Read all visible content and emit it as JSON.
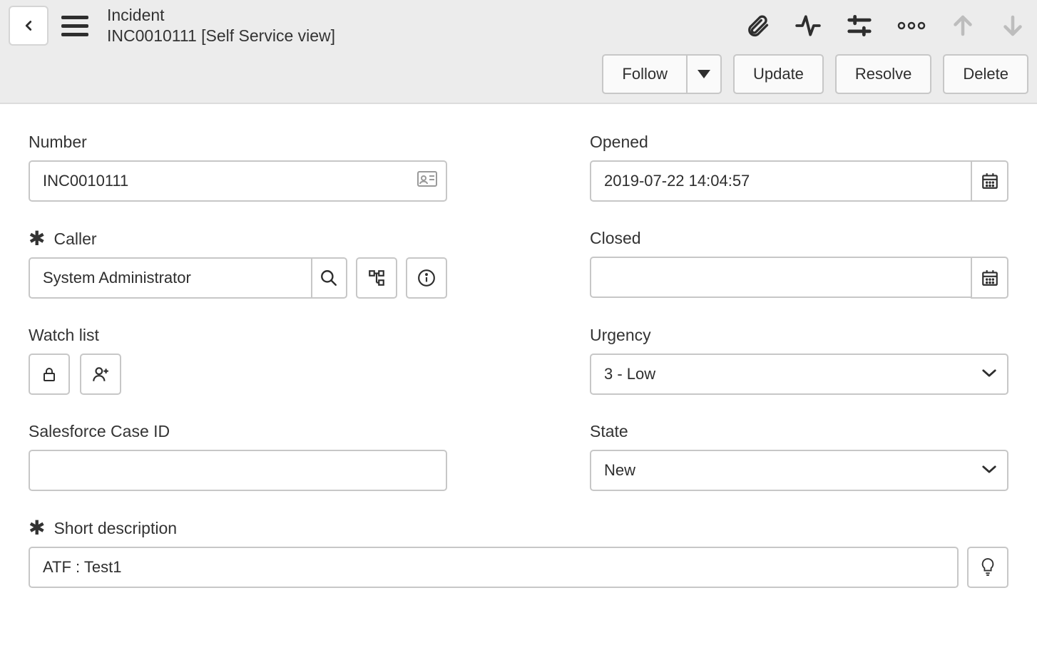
{
  "header": {
    "title": "Incident",
    "subtitle": "INC0010111 [Self Service view]"
  },
  "actions": {
    "follow": "Follow",
    "update": "Update",
    "resolve": "Resolve",
    "delete": "Delete"
  },
  "form": {
    "number": {
      "label": "Number",
      "value": "INC0010111"
    },
    "opened": {
      "label": "Opened",
      "value": "2019-07-22 14:04:57"
    },
    "caller": {
      "label": "Caller",
      "value": "System Administrator"
    },
    "closed": {
      "label": "Closed",
      "value": ""
    },
    "watch_list": {
      "label": "Watch list"
    },
    "urgency": {
      "label": "Urgency",
      "value": "3 - Low"
    },
    "salesforce": {
      "label": "Salesforce Case ID",
      "value": ""
    },
    "state": {
      "label": "State",
      "value": "New"
    },
    "short_desc": {
      "label": "Short description",
      "value": "ATF : Test1"
    }
  }
}
